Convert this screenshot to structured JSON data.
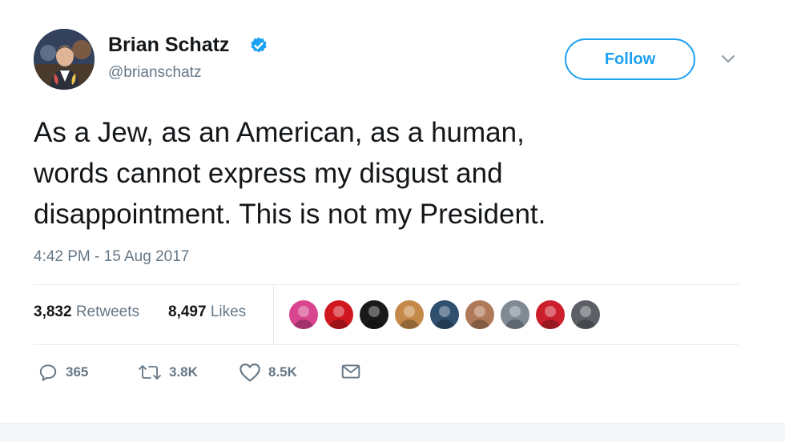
{
  "author": {
    "name": "Brian Schatz",
    "handle": "@brianschatz",
    "verified": true
  },
  "follow_label": "Follow",
  "tweet": {
    "lines": [
      "As a Jew, as an American, as a human,",
      "words cannot express my disgust and",
      "disappointment. This is not my President."
    ],
    "timestamp": "4:42 PM - 15 Aug 2017"
  },
  "stats": {
    "retweets_count": "3,832",
    "retweets_label": "Retweets",
    "likes_count": "8,497",
    "likes_label": "Likes"
  },
  "liker_avatars": [
    {
      "name": "liker-1",
      "color": "#d9468f"
    },
    {
      "name": "liker-2",
      "color": "#d0171f"
    },
    {
      "name": "liker-3",
      "color": "#1a1a1a"
    },
    {
      "name": "liker-4",
      "color": "#c58a4a"
    },
    {
      "name": "liker-5",
      "color": "#2f4f6f"
    },
    {
      "name": "liker-6",
      "color": "#b07a5a"
    },
    {
      "name": "liker-7",
      "color": "#7f8a95"
    },
    {
      "name": "liker-8",
      "color": "#cc1f2d"
    },
    {
      "name": "liker-9",
      "color": "#5c6066"
    }
  ],
  "actions": {
    "reply_count": "365",
    "retweet_count": "3.8K",
    "like_count": "8.5K"
  },
  "icons": {
    "verified": "verified-badge-icon",
    "caret": "chevron-down-icon",
    "reply": "reply-icon",
    "retweet": "retweet-icon",
    "like": "heart-icon",
    "dm": "envelope-icon"
  },
  "colors": {
    "accent": "#1da1f2",
    "text": "#14171a",
    "secondary": "#657786"
  }
}
